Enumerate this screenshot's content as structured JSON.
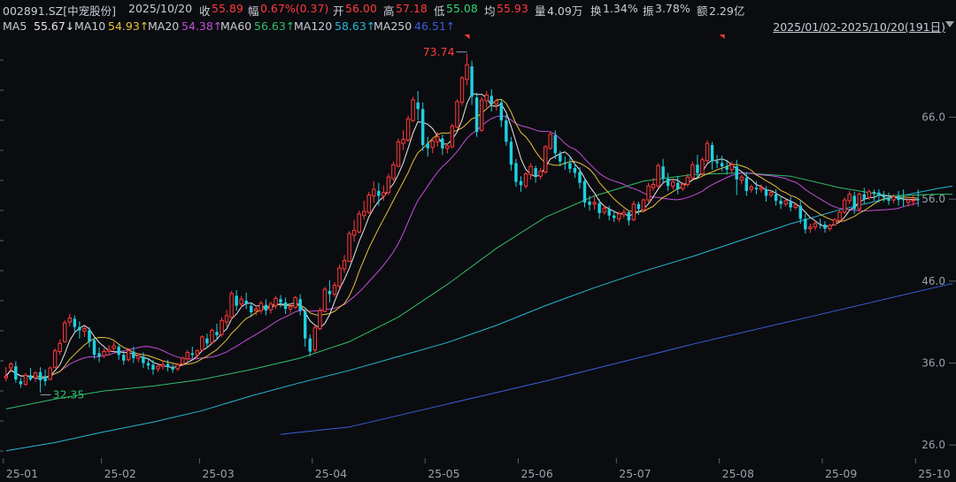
{
  "header": {
    "symbol": "002891.SZ[中宠股份]",
    "date": "2025/10/20",
    "close_label": "收",
    "close": "55.89",
    "change_label": "幅",
    "change": "0.67%(0.37)",
    "open_label": "开",
    "open": "56.00",
    "high_label": "高",
    "high": "57.18",
    "low_label": "低",
    "low": "55.08",
    "avg_label": "均",
    "avg": "55.93",
    "volume_label": "量",
    "volume": "4.09万",
    "turnover_label": "换",
    "turnover": "1.34%",
    "amplitude_label": "振",
    "amplitude": "3.78%",
    "amount_label": "额",
    "amount": "2.29亿"
  },
  "ma_legend": {
    "ma5_label": "MA5",
    "ma5": "55.67↓",
    "ma10_label": "MA10",
    "ma10": "54.93↑",
    "ma20_label": "MA20",
    "ma20": "54.38↑",
    "ma60_label": "MA60",
    "ma60": "56.63↑",
    "ma120_label": "MA120",
    "ma120": "58.63↑",
    "ma250_label": "MA250",
    "ma250": "46.51↑"
  },
  "date_range": "2025/01/02-2025/10/20(191日)",
  "colors": {
    "up": "#ff3b3b",
    "down": "#1fcfe0",
    "ma5": "#e8e8e8",
    "ma10": "#e6c23a",
    "ma20": "#c24fd6",
    "ma60": "#2fbf6a",
    "ma120": "#25b7d3",
    "ma250": "#3a5fd9"
  },
  "chart_data": {
    "type": "candlestick",
    "y_ticks": [
      "66.0",
      "56.0",
      "46.0",
      "36.0",
      "26.0"
    ],
    "y_tick_values": [
      66,
      56,
      46,
      36,
      26
    ],
    "ylim": [
      24.4,
      76.2
    ],
    "x_ticks": [
      "25-01",
      "25-02",
      "25-03",
      "25-04",
      "25-05",
      "25-06",
      "25-07",
      "25-08",
      "25-09",
      "25-10"
    ],
    "annotations": {
      "high_label": "73.74",
      "high_value": 73.74,
      "low_label": "32.35",
      "low_value": 32.35
    },
    "candles": [
      [
        34.2,
        35.5,
        34.4,
        33.8
      ],
      [
        35.4,
        36.1,
        35.9,
        34.9
      ],
      [
        35.6,
        36.2,
        34.0,
        33.6
      ],
      [
        33.8,
        34.2,
        33.4,
        33.0
      ],
      [
        33.4,
        34.8,
        34.5,
        33.2
      ],
      [
        34.5,
        35.4,
        34.0,
        33.8
      ],
      [
        34.2,
        35.0,
        34.8,
        33.7
      ],
      [
        34.9,
        35.5,
        33.9,
        32.4
      ],
      [
        34.4,
        35.2,
        33.8,
        33.2
      ],
      [
        34.0,
        35.6,
        35.4,
        33.9
      ],
      [
        35.5,
        37.8,
        37.5,
        35.3
      ],
      [
        37.4,
        38.9,
        38.4,
        37.0
      ],
      [
        38.6,
        41.2,
        40.9,
        38.5
      ],
      [
        41.0,
        42.0,
        41.5,
        40.5
      ],
      [
        41.4,
        41.8,
        40.4,
        39.6
      ],
      [
        40.4,
        41.1,
        40.0,
        39.0
      ],
      [
        39.9,
        40.6,
        40.2,
        39.2
      ],
      [
        40.0,
        40.4,
        38.6,
        37.9
      ],
      [
        38.8,
        39.1,
        37.0,
        36.5
      ],
      [
        37.2,
        37.9,
        36.8,
        36.1
      ],
      [
        36.9,
        37.8,
        37.4,
        36.6
      ],
      [
        37.4,
        38.2,
        37.6,
        37.0
      ],
      [
        37.8,
        38.6,
        38.1,
        37.4
      ],
      [
        38.0,
        38.3,
        37.0,
        36.4
      ],
      [
        37.0,
        37.5,
        36.3,
        35.8
      ],
      [
        36.4,
        37.8,
        37.5,
        36.2
      ],
      [
        37.4,
        38.0,
        36.6,
        36.0
      ],
      [
        36.6,
        37.2,
        36.9,
        36.1
      ],
      [
        36.8,
        37.3,
        36.0,
        35.4
      ],
      [
        36.0,
        36.6,
        35.7,
        35.2
      ],
      [
        35.8,
        36.4,
        35.2,
        34.6
      ],
      [
        35.3,
        35.9,
        35.6,
        34.9
      ],
      [
        35.6,
        36.3,
        35.8,
        35.2
      ],
      [
        35.9,
        36.4,
        35.5,
        35.0
      ],
      [
        35.5,
        35.9,
        35.2,
        34.8
      ],
      [
        35.3,
        36.0,
        35.8,
        35.0
      ],
      [
        35.9,
        36.8,
        36.6,
        35.6
      ],
      [
        36.5,
        37.6,
        37.3,
        36.2
      ],
      [
        37.2,
        38.0,
        37.0,
        36.6
      ],
      [
        37.0,
        37.7,
        37.5,
        36.6
      ],
      [
        37.6,
        39.4,
        39.2,
        37.4
      ],
      [
        39.0,
        39.6,
        38.4,
        37.8
      ],
      [
        38.5,
        40.2,
        40.0,
        38.3
      ],
      [
        39.8,
        40.8,
        39.4,
        38.9
      ],
      [
        39.5,
        41.6,
        41.2,
        39.2
      ],
      [
        41.0,
        42.5,
        41.8,
        40.4
      ],
      [
        41.6,
        44.8,
        44.5,
        41.3
      ],
      [
        44.2,
        44.9,
        43.0,
        42.4
      ],
      [
        43.2,
        44.2,
        43.8,
        42.8
      ],
      [
        43.6,
        44.6,
        43.2,
        42.6
      ],
      [
        43.0,
        43.4,
        42.2,
        41.6
      ],
      [
        42.4,
        43.0,
        42.6,
        41.8
      ],
      [
        42.4,
        43.6,
        43.3,
        42.0
      ],
      [
        43.1,
        43.8,
        42.4,
        41.8
      ],
      [
        42.5,
        43.5,
        43.2,
        42.0
      ],
      [
        43.0,
        44.2,
        43.9,
        42.6
      ],
      [
        43.8,
        44.3,
        43.4,
        42.8
      ],
      [
        43.4,
        44.0,
        42.6,
        42.0
      ],
      [
        42.6,
        43.2,
        42.9,
        42.1
      ],
      [
        42.8,
        44.2,
        44.0,
        42.6
      ],
      [
        43.8,
        44.4,
        42.4,
        41.8
      ],
      [
        42.3,
        42.8,
        39.0,
        38.0
      ],
      [
        39.0,
        39.5,
        37.4,
        36.8
      ],
      [
        37.6,
        40.6,
        40.3,
        37.3
      ],
      [
        40.2,
        42.8,
        42.4,
        40.0
      ],
      [
        42.3,
        45.3,
        45.0,
        42.2
      ],
      [
        44.8,
        46.1,
        44.4,
        43.4
      ],
      [
        44.4,
        45.9,
        45.5,
        44.1
      ],
      [
        45.4,
        48.0,
        47.6,
        45.1
      ],
      [
        47.5,
        49.2,
        48.5,
        47.0
      ],
      [
        48.4,
        52.1,
        51.8,
        48.3
      ],
      [
        51.6,
        53.5,
        52.2,
        50.8
      ],
      [
        52.0,
        54.6,
        54.2,
        51.8
      ],
      [
        54.0,
        55.8,
        54.5,
        53.5
      ],
      [
        54.4,
        56.9,
        56.5,
        54.2
      ],
      [
        56.4,
        58.2,
        57.2,
        55.6
      ],
      [
        57.0,
        58.0,
        56.4,
        55.2
      ],
      [
        56.4,
        57.7,
        56.8,
        55.8
      ],
      [
        56.8,
        59.1,
        58.7,
        56.5
      ],
      [
        58.5,
        60.6,
        60.2,
        58.2
      ],
      [
        60.0,
        63.4,
        63.0,
        59.9
      ],
      [
        62.8,
        64.4,
        63.3,
        62.0
      ],
      [
        63.2,
        66.2,
        65.8,
        63.0
      ],
      [
        65.6,
        68.5,
        68.1,
        65.4
      ],
      [
        67.8,
        69.2,
        67.0,
        65.6
      ],
      [
        67.0,
        67.8,
        62.6,
        61.9
      ],
      [
        62.8,
        63.6,
        62.2,
        61.2
      ],
      [
        62.3,
        63.5,
        63.1,
        61.6
      ],
      [
        63.0,
        64.2,
        63.6,
        62.4
      ],
      [
        63.4,
        63.9,
        62.2,
        61.4
      ],
      [
        62.2,
        62.8,
        62.5,
        61.6
      ],
      [
        62.4,
        65.2,
        64.9,
        62.2
      ],
      [
        64.8,
        68.2,
        67.9,
        64.6
      ],
      [
        67.8,
        71.0,
        70.8,
        67.4
      ],
      [
        70.6,
        73.74,
        72.4,
        69.9
      ],
      [
        72.2,
        72.9,
        68.5,
        67.5
      ],
      [
        68.4,
        69.0,
        64.2,
        63.6
      ],
      [
        64.4,
        68.5,
        68.1,
        64.2
      ],
      [
        68.0,
        69.2,
        68.7,
        67.2
      ],
      [
        68.6,
        69.4,
        67.6,
        66.7
      ],
      [
        67.6,
        68.1,
        68.0,
        66.8
      ],
      [
        67.8,
        68.2,
        65.6,
        64.8
      ],
      [
        65.6,
        66.3,
        63.0,
        62.5
      ],
      [
        63.0,
        63.6,
        60.2,
        59.5
      ],
      [
        60.4,
        60.9,
        58.1,
        57.5
      ],
      [
        58.2,
        58.8,
        57.7,
        56.9
      ],
      [
        57.6,
        59.3,
        59.1,
        57.3
      ],
      [
        59.0,
        60.4,
        60.0,
        58.4
      ],
      [
        59.8,
        60.1,
        58.8,
        58.0
      ],
      [
        58.8,
        59.8,
        59.4,
        58.4
      ],
      [
        59.3,
        62.6,
        62.4,
        59.1
      ],
      [
        62.2,
        64.2,
        63.9,
        62.0
      ],
      [
        63.8,
        64.4,
        61.6,
        60.9
      ],
      [
        61.5,
        61.9,
        60.6,
        60.0
      ],
      [
        60.5,
        61.2,
        60.3,
        59.6
      ],
      [
        60.4,
        61.2,
        59.7,
        59.2
      ],
      [
        59.8,
        60.4,
        59.2,
        58.6
      ],
      [
        59.3,
        59.9,
        58.0,
        57.3
      ],
      [
        58.2,
        58.6,
        55.6,
        55.0
      ],
      [
        55.7,
        56.4,
        55.3,
        54.6
      ],
      [
        55.4,
        56.3,
        55.6,
        54.7
      ],
      [
        55.5,
        56.0,
        54.3,
        53.6
      ],
      [
        54.4,
        55.3,
        54.9,
        54.1
      ],
      [
        54.8,
        55.2,
        54.0,
        53.4
      ],
      [
        54.0,
        54.6,
        53.7,
        53.2
      ],
      [
        53.6,
        54.5,
        54.2,
        53.2
      ],
      [
        54.1,
        54.8,
        54.4,
        53.7
      ],
      [
        54.4,
        54.6,
        53.4,
        52.8
      ],
      [
        53.5,
        55.8,
        55.4,
        53.3
      ],
      [
        55.4,
        55.7,
        54.8,
        54.1
      ],
      [
        54.7,
        56.1,
        55.9,
        54.4
      ],
      [
        55.9,
        58.0,
        57.6,
        55.6
      ],
      [
        57.4,
        58.6,
        57.8,
        57.0
      ],
      [
        57.6,
        60.4,
        60.1,
        57.4
      ],
      [
        60.0,
        60.9,
        58.5,
        58.0
      ],
      [
        58.5,
        59.2,
        57.6,
        57.0
      ],
      [
        57.6,
        58.4,
        58.1,
        57.2
      ],
      [
        58.0,
        58.8,
        57.2,
        56.6
      ],
      [
        57.3,
        58.1,
        57.8,
        57.0
      ],
      [
        57.8,
        59.1,
        58.7,
        57.5
      ],
      [
        58.6,
        60.6,
        60.2,
        58.4
      ],
      [
        60.2,
        61.4,
        59.2,
        58.6
      ],
      [
        59.1,
        61.1,
        60.8,
        58.9
      ],
      [
        60.7,
        63.2,
        62.8,
        60.5
      ],
      [
        62.6,
        63.0,
        60.6,
        59.6
      ],
      [
        60.6,
        61.4,
        60.4,
        59.8
      ],
      [
        60.4,
        61.3,
        60.0,
        59.4
      ],
      [
        60.0,
        60.8,
        59.6,
        59.0
      ],
      [
        59.6,
        60.6,
        60.2,
        59.2
      ],
      [
        60.0,
        60.8,
        58.4,
        56.5
      ],
      [
        58.3,
        59.0,
        58.7,
        57.8
      ],
      [
        58.6,
        59.3,
        57.0,
        56.4
      ],
      [
        57.2,
        57.8,
        57.5,
        56.8
      ],
      [
        57.4,
        58.2,
        57.2,
        56.6
      ],
      [
        57.2,
        57.8,
        57.4,
        56.8
      ],
      [
        57.2,
        57.6,
        56.4,
        55.7
      ],
      [
        56.5,
        57.1,
        56.8,
        56.2
      ],
      [
        56.6,
        57.2,
        55.8,
        55.2
      ],
      [
        55.8,
        56.4,
        55.4,
        54.8
      ],
      [
        55.4,
        56.0,
        55.8,
        55.1
      ],
      [
        55.7,
        56.3,
        55.0,
        54.5
      ],
      [
        55.0,
        55.6,
        55.3,
        54.7
      ],
      [
        55.2,
        55.9,
        53.6,
        53.0
      ],
      [
        53.6,
        54.2,
        52.3,
        51.8
      ],
      [
        52.4,
        53.0,
        52.6,
        51.9
      ],
      [
        52.6,
        53.4,
        53.0,
        52.2
      ],
      [
        53.0,
        53.6,
        52.9,
        52.4
      ],
      [
        52.9,
        53.3,
        52.4,
        51.9
      ],
      [
        52.4,
        53.0,
        52.8,
        52.1
      ],
      [
        52.9,
        53.7,
        53.5,
        52.7
      ],
      [
        53.4,
        54.6,
        54.4,
        53.2
      ],
      [
        54.4,
        56.2,
        55.9,
        54.2
      ],
      [
        55.8,
        57.0,
        56.6,
        55.4
      ],
      [
        56.4,
        56.9,
        54.8,
        54.2
      ],
      [
        54.8,
        56.8,
        56.6,
        54.6
      ],
      [
        56.6,
        57.4,
        56.0,
        55.4
      ],
      [
        56.2,
        57.2,
        56.9,
        55.9
      ],
      [
        56.9,
        57.2,
        56.7,
        55.8
      ],
      [
        56.8,
        57.2,
        56.4,
        55.6
      ],
      [
        56.4,
        57.0,
        56.2,
        55.7
      ],
      [
        56.2,
        56.8,
        55.8,
        55.3
      ],
      [
        55.9,
        56.6,
        56.3,
        55.5
      ],
      [
        56.3,
        57.0,
        55.9,
        55.2
      ],
      [
        56.0,
        57.18,
        55.89,
        55.08
      ],
      [
        55.6,
        56.2,
        55.9,
        55.1
      ],
      [
        55.8,
        56.5,
        55.89,
        55.2
      ],
      [
        56.0,
        57.18,
        55.89,
        55.08
      ]
    ],
    "ma120_series": [
      [
        0,
        25.3
      ],
      [
        10,
        26.3
      ],
      [
        20,
        27.6
      ],
      [
        30,
        28.8
      ],
      [
        40,
        30.2
      ],
      [
        50,
        32.0
      ],
      [
        60,
        33.6
      ],
      [
        70,
        35.1
      ],
      [
        80,
        36.8
      ],
      [
        90,
        38.5
      ],
      [
        100,
        40.6
      ],
      [
        110,
        43.0
      ],
      [
        120,
        45.2
      ],
      [
        130,
        47.2
      ],
      [
        140,
        49.0
      ],
      [
        150,
        51.0
      ],
      [
        160,
        53.0
      ],
      [
        170,
        54.7
      ],
      [
        180,
        56.1
      ],
      [
        190,
        57.3
      ],
      [
        193,
        57.6
      ]
    ],
    "ma250_series": [
      [
        56,
        27.3
      ],
      [
        70,
        28.2
      ],
      [
        80,
        29.6
      ],
      [
        90,
        31.0
      ],
      [
        100,
        32.4
      ],
      [
        110,
        33.8
      ],
      [
        120,
        35.3
      ],
      [
        130,
        36.8
      ],
      [
        140,
        38.3
      ],
      [
        150,
        39.7
      ],
      [
        160,
        41.1
      ],
      [
        170,
        42.5
      ],
      [
        180,
        43.9
      ],
      [
        190,
        45.3
      ],
      [
        193,
        45.7
      ]
    ],
    "ma60_series": [
      [
        0,
        30.4
      ],
      [
        10,
        31.6
      ],
      [
        20,
        32.6
      ],
      [
        30,
        33.2
      ],
      [
        40,
        34.0
      ],
      [
        50,
        35.2
      ],
      [
        60,
        36.6
      ],
      [
        70,
        38.6
      ],
      [
        80,
        41.6
      ],
      [
        90,
        45.6
      ],
      [
        100,
        50.0
      ],
      [
        110,
        53.8
      ],
      [
        120,
        56.4
      ],
      [
        130,
        58.2
      ],
      [
        140,
        59.0
      ],
      [
        150,
        59.2
      ],
      [
        160,
        58.8
      ],
      [
        170,
        57.4
      ],
      [
        180,
        56.4
      ],
      [
        190,
        56.6
      ],
      [
        193,
        56.6
      ]
    ]
  }
}
